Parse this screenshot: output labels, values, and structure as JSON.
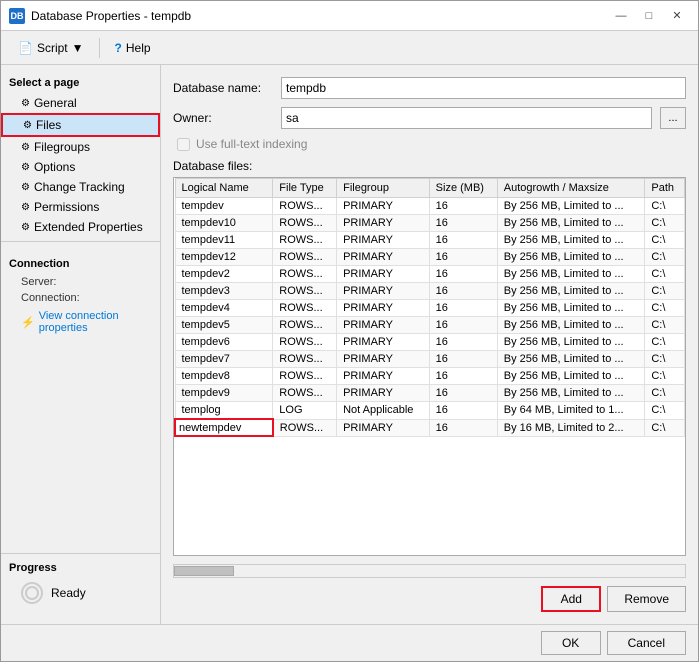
{
  "window": {
    "title": "Database Properties - tempdb",
    "icon_label": "DB"
  },
  "title_controls": {
    "minimize": "—",
    "maximize": "□",
    "close": "✕"
  },
  "toolbar": {
    "script_label": "Script",
    "script_arrow": "▼",
    "help_label": "Help"
  },
  "sidebar": {
    "section_title": "Select a page",
    "items": [
      {
        "id": "general",
        "label": "General",
        "icon": "⚙"
      },
      {
        "id": "files",
        "label": "Files",
        "icon": "⚙",
        "active": true,
        "highlighted": true
      },
      {
        "id": "filegroups",
        "label": "Filegroups",
        "icon": "⚙"
      },
      {
        "id": "options",
        "label": "Options",
        "icon": "⚙"
      },
      {
        "id": "change-tracking",
        "label": "Change Tracking",
        "icon": "⚙"
      },
      {
        "id": "permissions",
        "label": "Permissions",
        "icon": "⚙"
      },
      {
        "id": "extended-properties",
        "label": "Extended Properties",
        "icon": "⚙"
      }
    ],
    "connection_section": "Connection",
    "server_label": "Server:",
    "server_value": "",
    "connection_label": "Connection:",
    "connection_value": "",
    "view_props_label": "View connection properties",
    "progress_section": "Progress",
    "progress_status": "Ready"
  },
  "form": {
    "db_name_label": "Database name:",
    "db_name_value": "tempdb",
    "owner_label": "Owner:",
    "owner_value": "sa",
    "owner_browse_label": "...",
    "fulltext_label": "Use full-text indexing",
    "fulltext_checked": false
  },
  "table": {
    "section_label": "Database files:",
    "columns": [
      "Logical Name",
      "File Type",
      "Filegroup",
      "Size (MB)",
      "Autogrowth / Maxsize",
      "Path"
    ],
    "rows": [
      {
        "logical_name": "tempdev",
        "file_type": "ROWS...",
        "filegroup": "PRIMARY",
        "size": "16",
        "autogrowth": "By 256 MB, Limited to ...",
        "path": "C:\\"
      },
      {
        "logical_name": "tempdev10",
        "file_type": "ROWS...",
        "filegroup": "PRIMARY",
        "size": "16",
        "autogrowth": "By 256 MB, Limited to ...",
        "path": "C:\\"
      },
      {
        "logical_name": "tempdev11",
        "file_type": "ROWS...",
        "filegroup": "PRIMARY",
        "size": "16",
        "autogrowth": "By 256 MB, Limited to ...",
        "path": "C:\\"
      },
      {
        "logical_name": "tempdev12",
        "file_type": "ROWS...",
        "filegroup": "PRIMARY",
        "size": "16",
        "autogrowth": "By 256 MB, Limited to ...",
        "path": "C:\\"
      },
      {
        "logical_name": "tempdev2",
        "file_type": "ROWS...",
        "filegroup": "PRIMARY",
        "size": "16",
        "autogrowth": "By 256 MB, Limited to ...",
        "path": "C:\\"
      },
      {
        "logical_name": "tempdev3",
        "file_type": "ROWS...",
        "filegroup": "PRIMARY",
        "size": "16",
        "autogrowth": "By 256 MB, Limited to ...",
        "path": "C:\\"
      },
      {
        "logical_name": "tempdev4",
        "file_type": "ROWS...",
        "filegroup": "PRIMARY",
        "size": "16",
        "autogrowth": "By 256 MB, Limited to ...",
        "path": "C:\\"
      },
      {
        "logical_name": "tempdev5",
        "file_type": "ROWS...",
        "filegroup": "PRIMARY",
        "size": "16",
        "autogrowth": "By 256 MB, Limited to ...",
        "path": "C:\\"
      },
      {
        "logical_name": "tempdev6",
        "file_type": "ROWS...",
        "filegroup": "PRIMARY",
        "size": "16",
        "autogrowth": "By 256 MB, Limited to ...",
        "path": "C:\\"
      },
      {
        "logical_name": "tempdev7",
        "file_type": "ROWS...",
        "filegroup": "PRIMARY",
        "size": "16",
        "autogrowth": "By 256 MB, Limited to ...",
        "path": "C:\\"
      },
      {
        "logical_name": "tempdev8",
        "file_type": "ROWS...",
        "filegroup": "PRIMARY",
        "size": "16",
        "autogrowth": "By 256 MB, Limited to ...",
        "path": "C:\\"
      },
      {
        "logical_name": "tempdev9",
        "file_type": "ROWS...",
        "filegroup": "PRIMARY",
        "size": "16",
        "autogrowth": "By 256 MB, Limited to ...",
        "path": "C:\\"
      },
      {
        "logical_name": "templog",
        "file_type": "LOG",
        "filegroup": "Not Applicable",
        "size": "16",
        "autogrowth": "By 64 MB, Limited to 1...",
        "path": "C:\\"
      },
      {
        "logical_name": "newtempdev",
        "file_type": "ROWS...",
        "filegroup": "PRIMARY",
        "size": "16",
        "autogrowth": "By 16 MB, Limited to 2...",
        "path": "C:\\",
        "editing": true
      }
    ]
  },
  "buttons": {
    "add_label": "Add",
    "remove_label": "Remove",
    "ok_label": "OK",
    "cancel_label": "Cancel"
  },
  "colors": {
    "highlight_red": "#e81123",
    "accent_blue": "#0078d7",
    "light_blue_selected": "#cce4f7"
  }
}
